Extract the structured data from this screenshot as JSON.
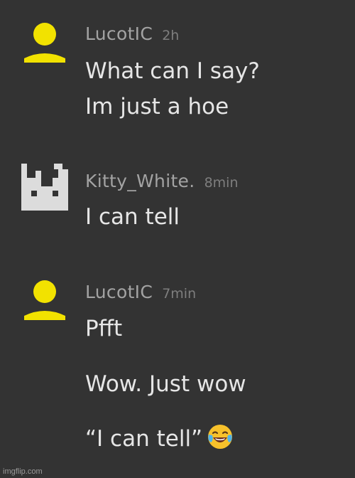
{
  "colors": {
    "background": "#333333",
    "username": "#a3a3a3",
    "timestamp": "#7e7e7e",
    "message": "#e6e6e6",
    "yellow_avatar": "#f2e200",
    "white_avatar": "#dcdcdc"
  },
  "comments": [
    {
      "avatar": "yellow-person-icon",
      "username": "LucotIC",
      "time": "2h",
      "lines": [
        "What can I say?",
        "Im just a hoe"
      ]
    },
    {
      "avatar": "pixel-cat-icon",
      "username": "Kitty_White.",
      "time": "8min",
      "lines": [
        "I can tell"
      ]
    },
    {
      "avatar": "yellow-person-icon",
      "username": "LucotIC",
      "time": "7min",
      "lines": [
        "Pfft",
        "Wow. Just wow",
        "“I can tell”"
      ],
      "emoji": "laughing-crying-emoji"
    }
  ],
  "watermark": "imgflip.com"
}
